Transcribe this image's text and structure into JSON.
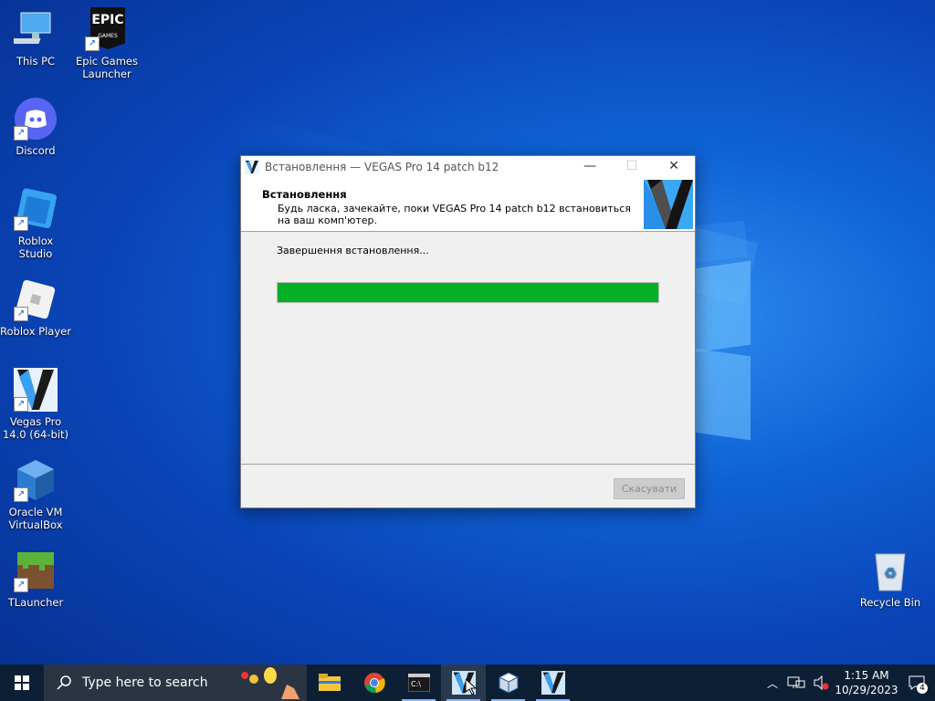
{
  "desktop": {
    "icons": [
      {
        "label_1": "This PC",
        "label_2": ""
      },
      {
        "label_1": "Epic Games",
        "label_2": "Launcher"
      },
      {
        "label_1": "Discord",
        "label_2": ""
      },
      {
        "label_1": "Roblox Studio",
        "label_2": ""
      },
      {
        "label_1": "Roblox Player",
        "label_2": ""
      },
      {
        "label_1": "Vegas Pro",
        "label_2": "14.0 (64-bit)"
      },
      {
        "label_1": "Oracle VM",
        "label_2": "VirtualBox"
      },
      {
        "label_1": "TLauncher",
        "label_2": ""
      },
      {
        "label_1": "Recycle Bin",
        "label_2": ""
      }
    ],
    "epic_logo_text_1": "EPIC",
    "epic_logo_text_2": "GAMES"
  },
  "installer": {
    "title": "Встановлення — VEGAS Pro 14 patch b12",
    "header_title": "Встановлення",
    "header_subtitle": "Будь ласка, зачекайте, поки VEGAS Pro 14 patch b12 встановиться на ваш комп'ютер.",
    "status_text": "Завершення встановлення...",
    "progress": 1.0,
    "cancel_label": "Скасувати",
    "minimize_glyph": "—",
    "maximize_glyph": "☐",
    "close_glyph": "✕"
  },
  "taskbar": {
    "search_placeholder": "Type here to search",
    "apps": [
      "file-explorer",
      "chrome",
      "terminal",
      "vegas-installer",
      "virtualbox",
      "vegas-pro"
    ],
    "clock_time": "1:15 AM",
    "clock_date": "10/29/2023",
    "notification_count": "4"
  },
  "colors": {
    "progress_fill": "#06b025",
    "taskbar_bg": "#0d1f35",
    "desktop_blue": "#0f63d6"
  }
}
